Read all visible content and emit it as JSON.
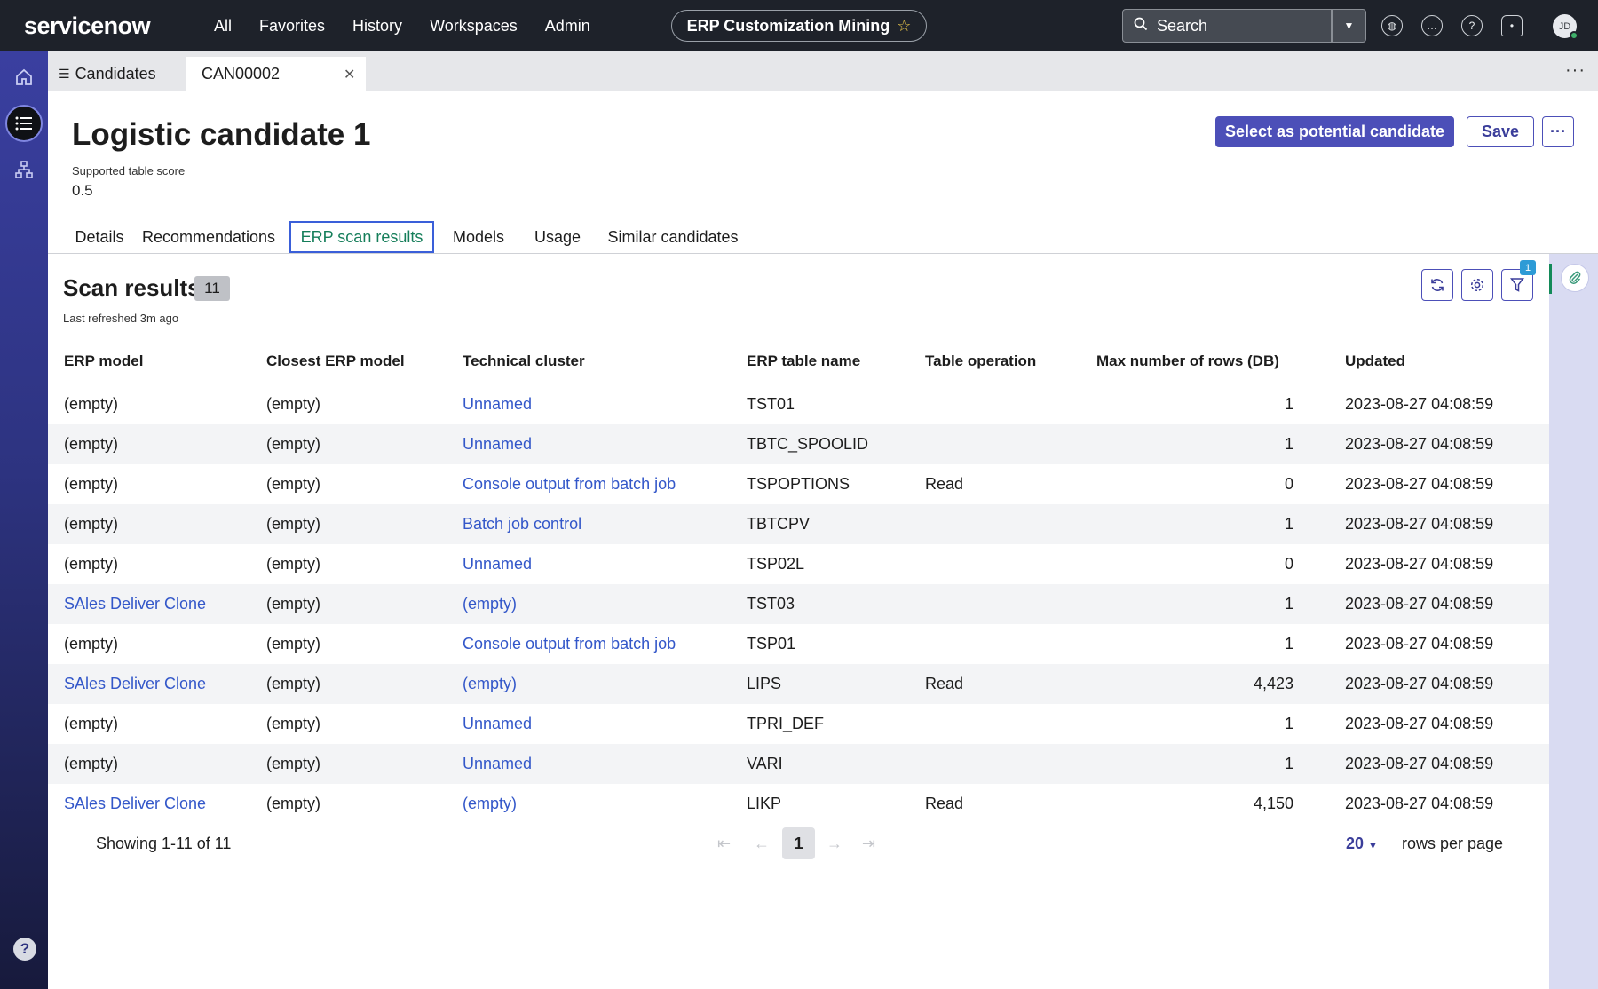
{
  "topnav": {
    "logo": "servicenow",
    "menu": [
      "All",
      "Favorites",
      "History",
      "Workspaces",
      "Admin"
    ],
    "app_title": "ERP Customization Mining",
    "search_placeholder": "Search",
    "avatar_initials": "JD"
  },
  "tabs": {
    "list_tab": "Candidates",
    "record_tab": "CAN00002"
  },
  "record": {
    "title": "Logistic candidate 1",
    "score_label": "Supported table score",
    "score_value": "0.5",
    "actions": {
      "primary": "Select as potential candidate",
      "save": "Save"
    }
  },
  "section_tabs": [
    "Details",
    "Recommendations",
    "ERP scan results",
    "Models",
    "Usage",
    "Similar candidates"
  ],
  "list": {
    "title": "Scan results",
    "count": "11",
    "refreshed": "Last refreshed 3m ago",
    "filter_badge": "1",
    "columns": [
      "ERP model",
      "Closest ERP model",
      "Technical cluster",
      "ERP table name",
      "Table operation",
      "Max number of rows (DB)",
      "Updated"
    ],
    "rows": [
      [
        "(empty)",
        "(empty)",
        "Unnamed",
        "TST01",
        "",
        "1",
        "2023-08-27 04:08:59"
      ],
      [
        "(empty)",
        "(empty)",
        "Unnamed",
        "TBTC_SPOOLID",
        "",
        "1",
        "2023-08-27 04:08:59"
      ],
      [
        "(empty)",
        "(empty)",
        "Console output from batch job",
        "TSPOPTIONS",
        "Read",
        "0",
        "2023-08-27 04:08:59"
      ],
      [
        "(empty)",
        "(empty)",
        "Batch job control",
        "TBTCPV",
        "",
        "1",
        "2023-08-27 04:08:59"
      ],
      [
        "(empty)",
        "(empty)",
        "Unnamed",
        "TSP02L",
        "",
        "0",
        "2023-08-27 04:08:59"
      ],
      [
        "SAles Deliver Clone",
        "(empty)",
        "(empty)",
        "TST03",
        "",
        "1",
        "2023-08-27 04:08:59"
      ],
      [
        "(empty)",
        "(empty)",
        "Console output from batch job",
        "TSP01",
        "",
        "1",
        "2023-08-27 04:08:59"
      ],
      [
        "SAles Deliver Clone",
        "(empty)",
        "(empty)",
        "LIPS",
        "Read",
        "4,423",
        "2023-08-27 04:08:59"
      ],
      [
        "(empty)",
        "(empty)",
        "Unnamed",
        "TPRI_DEF",
        "",
        "1",
        "2023-08-27 04:08:59"
      ],
      [
        "(empty)",
        "(empty)",
        "Unnamed",
        "VARI",
        "",
        "1",
        "2023-08-27 04:08:59"
      ],
      [
        "SAles Deliver Clone",
        "(empty)",
        "(empty)",
        "LIKP",
        "Read",
        "4,150",
        "2023-08-27 04:08:59"
      ]
    ],
    "erp_model_links": [
      false,
      false,
      false,
      false,
      false,
      true,
      false,
      true,
      false,
      false,
      true
    ]
  },
  "pagination": {
    "showing": "Showing 1-11 of 11",
    "current_page": "1",
    "rows_per_page_value": "20",
    "rows_per_page_label": "rows per page"
  },
  "colors": {
    "accent": "#4c4fb8",
    "link": "#3357c9",
    "active_tab_text": "#157e5a",
    "nav_bg": "#1e222a"
  },
  "icons": {
    "search": "search-icon",
    "star": "star-icon",
    "globe": "globe-icon",
    "chat": "chat-icon",
    "help": "help-icon",
    "bell": "bell-icon",
    "home": "home-icon",
    "list": "list-icon",
    "hierarchy": "hierarchy-icon",
    "refresh": "refresh-icon",
    "settings": "gear-icon",
    "filter": "filter-icon",
    "attachment": "paperclip-icon"
  }
}
